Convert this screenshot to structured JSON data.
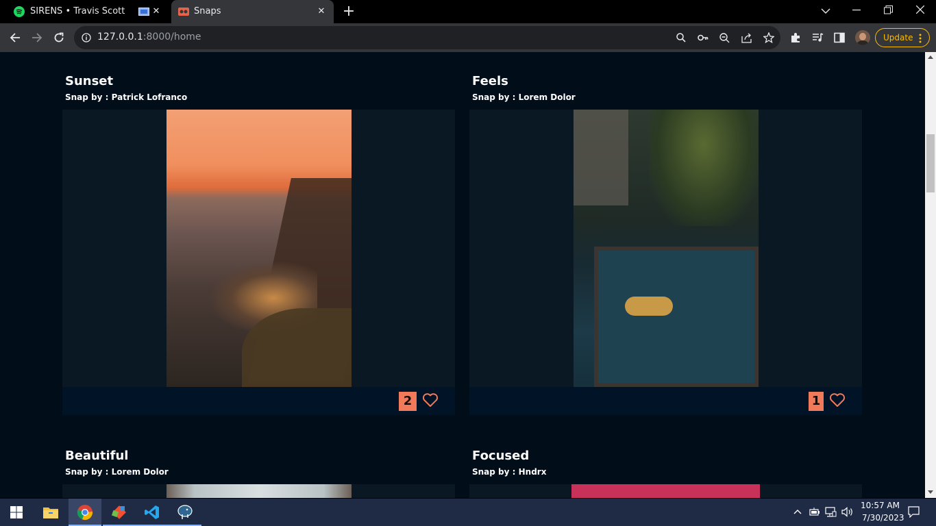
{
  "tabs": [
    {
      "title": "SIRENS • Travis Scott",
      "close": "✕"
    },
    {
      "title": "Snaps",
      "close": "✕"
    }
  ],
  "new_tab": "+",
  "address": {
    "host": "127.0.0.1",
    "rest": ":8000/home"
  },
  "update_label": "Update",
  "cards": [
    {
      "title": "Sunset",
      "byline": "Snap by : Patrick Lofranco",
      "likes": "2"
    },
    {
      "title": "Feels",
      "byline": "Snap by : Lorem Dolor",
      "likes": "1"
    },
    {
      "title": "Beautiful",
      "byline": "Snap by : Lorem Dolor"
    },
    {
      "title": "Focused",
      "byline": "Snap by : Hndrx"
    }
  ],
  "clock": {
    "time": "10:57 AM",
    "date": "7/30/2023"
  },
  "colors": {
    "accent": "#f07a5a",
    "page_bg": "#010e1a",
    "update": "#fbbc04"
  }
}
